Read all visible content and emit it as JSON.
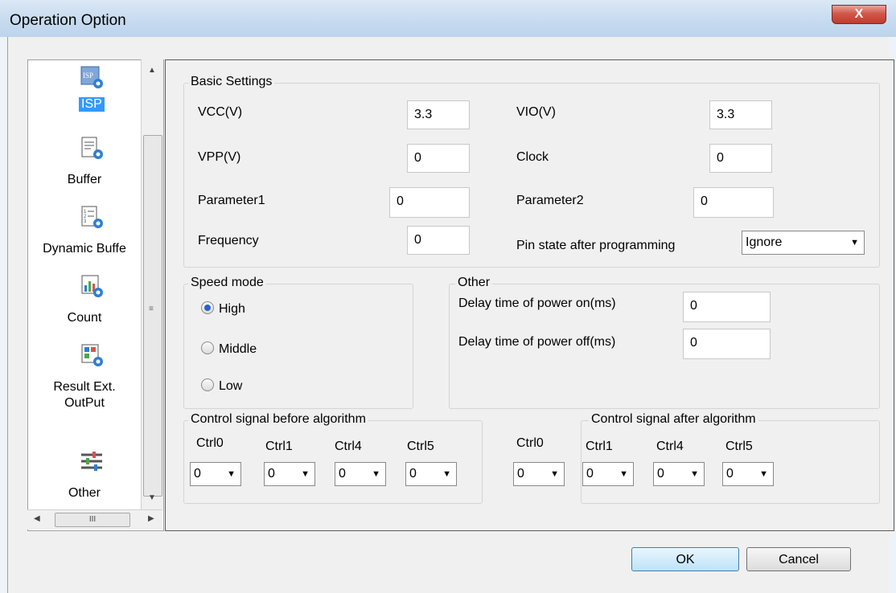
{
  "window": {
    "title": "Operation Option",
    "close_label": "X"
  },
  "nav": {
    "items": [
      {
        "label": "ISP",
        "icon": "isp-gear-icon",
        "selected": true
      },
      {
        "label": "Buffer",
        "icon": "buffer-gear-icon"
      },
      {
        "label": "Dynamic Buffe",
        "icon": "dynamic-buffer-gear-icon"
      },
      {
        "label": "Count",
        "icon": "count-gear-icon"
      },
      {
        "label": "Result Ext.",
        "label2": "OutPut",
        "icon": "result-output-gear-icon"
      },
      {
        "label": "Other",
        "icon": "sliders-icon"
      }
    ],
    "hscroll_thumb": "III"
  },
  "basic": {
    "title": "Basic Settings",
    "vcc_label": "VCC(V)",
    "vcc_value": "3.3",
    "vio_label": "VIO(V)",
    "vio_value": "3.3",
    "vpp_label": "VPP(V)",
    "vpp_value": "0",
    "clock_label": "Clock",
    "clock_value": "0",
    "param1_label": "Parameter1",
    "param1_value": "0",
    "param2_label": "Parameter2",
    "param2_value": "0",
    "freq_label": "Frequency",
    "freq_value": "0",
    "pin_label": "Pin state after programming",
    "pin_value": "Ignore"
  },
  "speed": {
    "title": "Speed mode",
    "options": [
      "High",
      "Middle",
      "Low"
    ],
    "selected": "High"
  },
  "other": {
    "title": "Other",
    "delay_on_label": "Delay time of power on(ms)",
    "delay_on_value": "0",
    "delay_off_label": "Delay time of power off(ms)",
    "delay_off_value": "0"
  },
  "ctrl_before": {
    "title": "Control signal before algorithm",
    "labels": [
      "Ctrl0",
      "Ctrl1",
      "Ctrl4",
      "Ctrl5"
    ],
    "values": [
      "0",
      "0",
      "0",
      "0"
    ]
  },
  "ctrl_after": {
    "title": "Control signal after algorithm",
    "labels": [
      "Ctrl0",
      "Ctrl1",
      "Ctrl4",
      "Ctrl5"
    ],
    "values": [
      "0",
      "0",
      "0",
      "0"
    ]
  },
  "buttons": {
    "ok": "OK",
    "cancel": "Cancel"
  },
  "colors": {
    "accent": "#3399ff",
    "close": "#c13a2c"
  }
}
